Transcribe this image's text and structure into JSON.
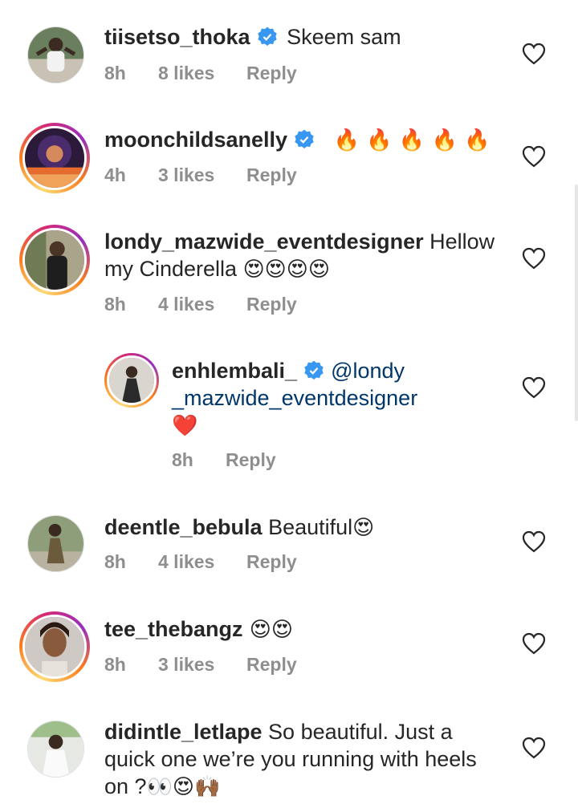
{
  "comments": [
    {
      "username": "tiisetso_thoka",
      "text": " Skeem sam",
      "time": "8h",
      "likes": "8 likes",
      "reply": "Reply"
    },
    {
      "username": "moonchildsanelly",
      "emoji": "🔥 🔥 🔥 🔥 🔥",
      "time": "4h",
      "likes": "3 likes",
      "reply": "Reply"
    },
    {
      "username": "londy_mazwide_eventdesigner",
      "text": " Hellow",
      "text2": "my Cinderella ",
      "emoji": "😍😍😍😍",
      "time": "8h",
      "likes": "4 likes",
      "reply": "Reply"
    },
    {
      "username": "enhlembali_",
      "mention1": "@londy",
      "mention2": "_mazwide_eventdesigner",
      "emoji": "❤️",
      "time": "8h",
      "reply": "Reply"
    },
    {
      "username": "deentle_bebula",
      "text": " Beautiful",
      "emoji": "😍",
      "time": "8h",
      "likes": "4 likes",
      "reply": "Reply"
    },
    {
      "username": "tee_thebangz",
      "emoji": " 😍😍",
      "time": "8h",
      "likes": "3 likes",
      "reply": "Reply"
    },
    {
      "username": "didintle_letlape",
      "text": " So beautiful. Just a",
      "text2": "quick one we’re you running with heels",
      "text3": "on ?",
      "emoji": "👀😍🙌🏾"
    }
  ],
  "colors": {
    "verified": "#3897f0",
    "meta": "#8e8e8e",
    "mention": "#00376b",
    "heart": "#262626"
  }
}
